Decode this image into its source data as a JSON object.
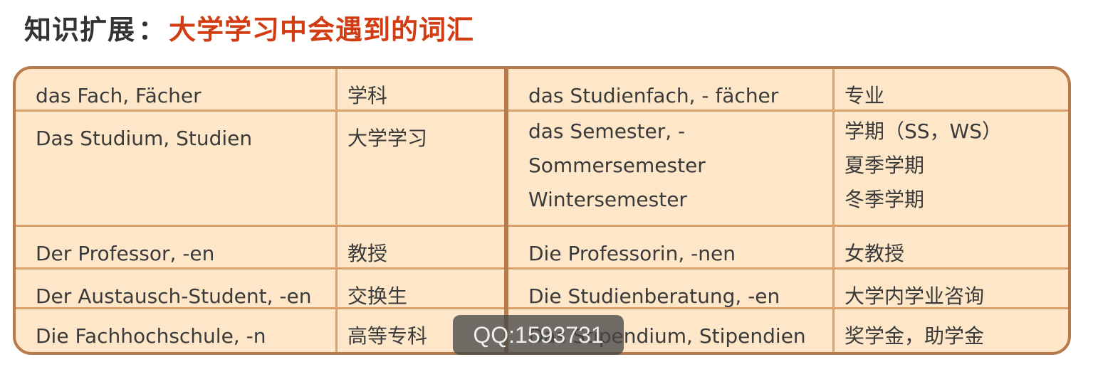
{
  "heading": {
    "prefix": "知识扩展",
    "colon": "：",
    "topic": "大学学习中会遇到的词汇"
  },
  "rows": [
    {
      "de_left": [
        "das Fach, Fächer"
      ],
      "zh_left": [
        "学科"
      ],
      "de_right": [
        "das Studienfach, - fächer"
      ],
      "zh_right": [
        "专业"
      ]
    },
    {
      "de_left": [
        "Das Studium, Studien"
      ],
      "zh_left": [
        "大学学习"
      ],
      "de_right": [
        "das Semester, -",
        "Sommersemester",
        "Wintersemester"
      ],
      "zh_right": [
        "学期（SS，WS）",
        "夏季学期",
        "冬季学期"
      ]
    },
    {
      "de_left": [
        "Der Professor, -en"
      ],
      "zh_left": [
        "教授"
      ],
      "de_right": [
        "Die Professorin, -nen"
      ],
      "zh_right": [
        "女教授"
      ]
    },
    {
      "de_left": [
        "Der Austausch-Student, -en"
      ],
      "zh_left": [
        "交换生"
      ],
      "de_right": [
        "Die Studienberatung, -en"
      ],
      "zh_right": [
        "大学内学业咨询"
      ]
    },
    {
      "de_left": [
        "Die Fachhochschule, -n"
      ],
      "zh_left": [
        "高等专科"
      ],
      "de_right": [
        "Das Stipendium, Stipendien"
      ],
      "zh_right": [
        "奖学金，助学金"
      ]
    }
  ],
  "watermark": "QQ:1593731"
}
